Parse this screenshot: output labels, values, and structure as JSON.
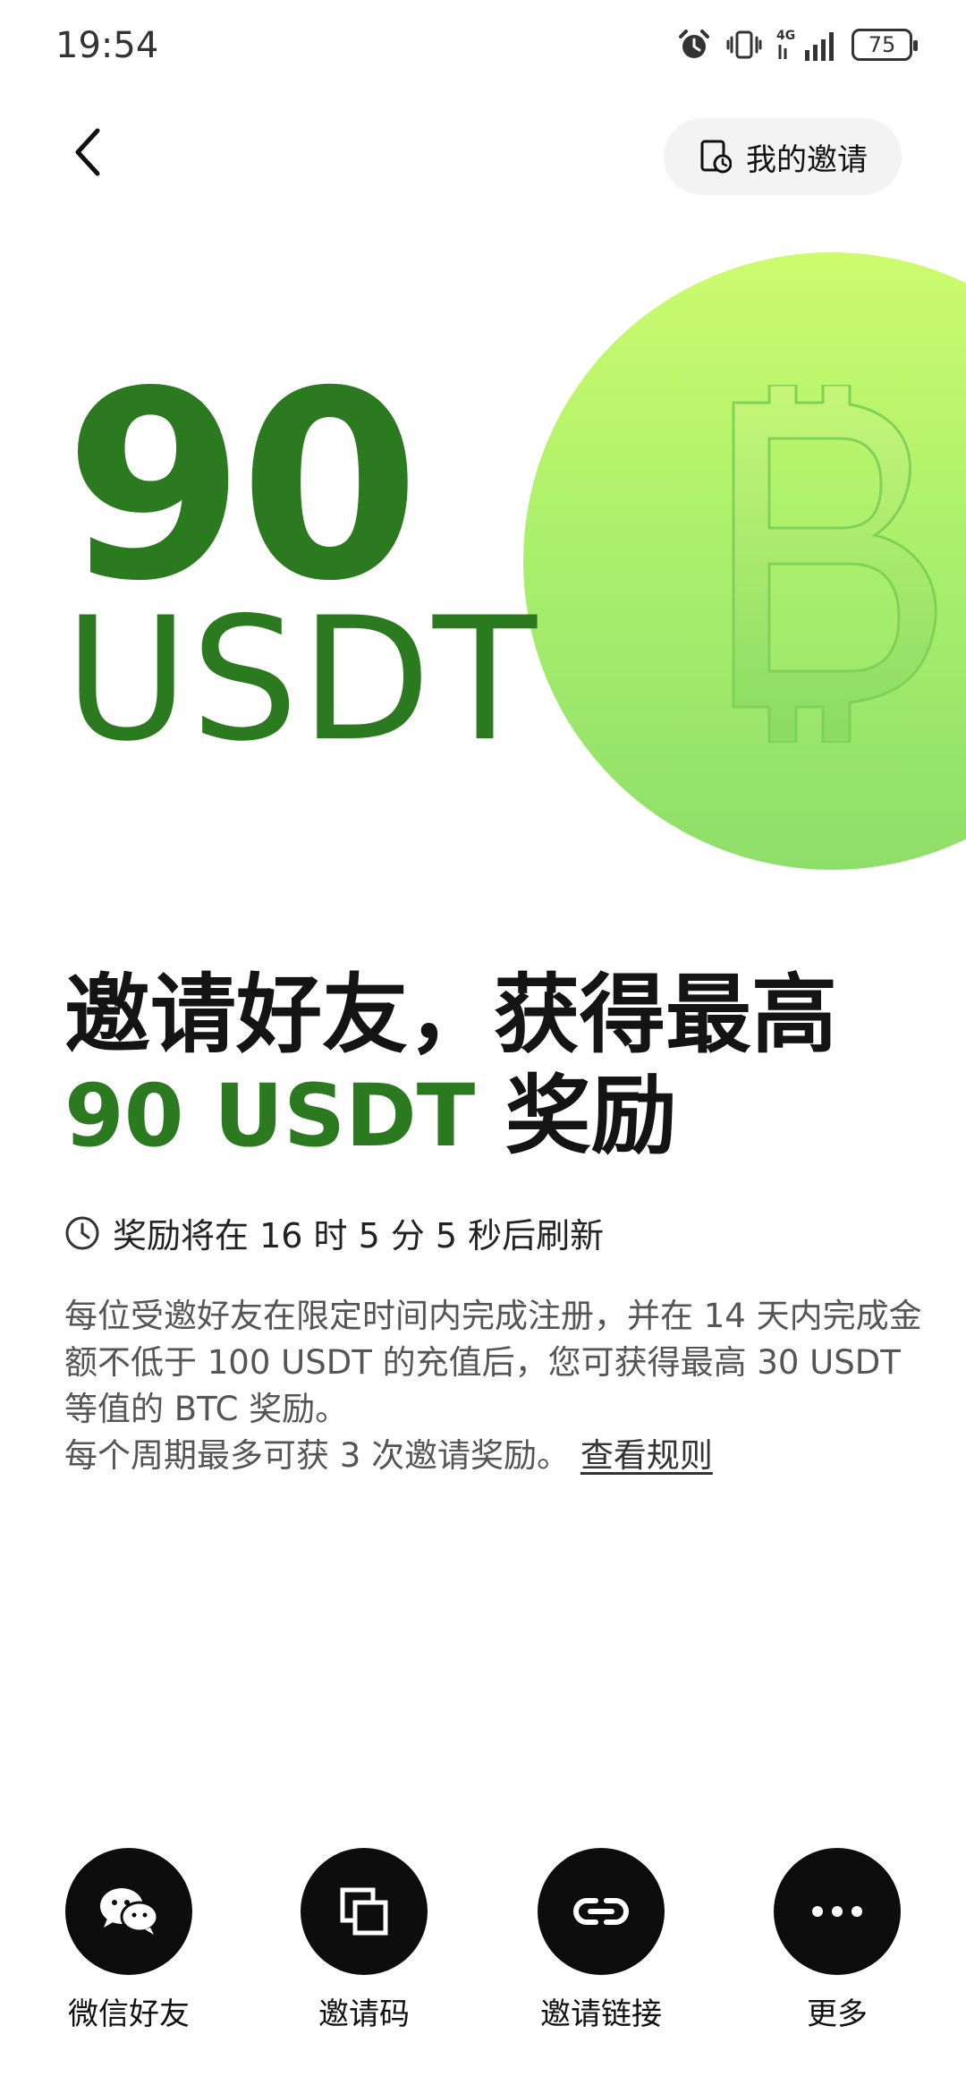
{
  "status_bar": {
    "time": "19:54",
    "network": "4G",
    "battery": "75",
    "icons": [
      "alarm-icon",
      "vibrate-icon",
      "signal-icon",
      "battery-icon"
    ]
  },
  "header": {
    "back_icon": "chevron-left-icon",
    "my_invites_icon": "invite-record-icon",
    "my_invites_label": "我的邀请"
  },
  "hero": {
    "amount": "90",
    "currency": "USDT",
    "coin_icon": "bitcoin-icon",
    "coin_colors": [
      "#cdfb6d",
      "#8ede6a"
    ],
    "accent_color": "#2c7a1f"
  },
  "headline": {
    "line1": "邀请好友，获得最高",
    "line2_highlight": "90 USDT",
    "line2_rest": " 奖励"
  },
  "countdown": {
    "icon": "clock-icon",
    "text": "奖励将在 16 时 5 分 5 秒后刷新"
  },
  "description": {
    "paragraph1": "每位受邀好友在限定时间内完成注册，并在 14 天内完成金额不低于 100 USDT 的充值后，您可获得最高 30 USDT 等值的 BTC 奖励。",
    "paragraph2": "每个周期最多可获 3 次邀请奖励。",
    "rules_link": "查看规则"
  },
  "share_options": [
    {
      "label": "微信好友",
      "icon": "wechat-icon"
    },
    {
      "label": "邀请码",
      "icon": "copy-icon"
    },
    {
      "label": "邀请链接",
      "icon": "link-icon"
    },
    {
      "label": "更多",
      "icon": "more-icon"
    }
  ]
}
